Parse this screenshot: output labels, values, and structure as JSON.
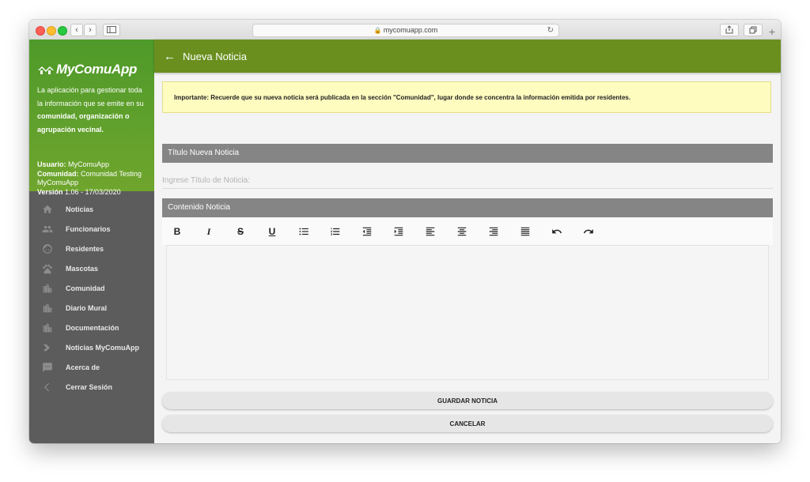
{
  "browser": {
    "url": "mycomuapp.com",
    "nav_back": "‹",
    "nav_forward": "›"
  },
  "sidebar": {
    "logo_text": "MyComuApp",
    "description": {
      "line1": "La aplicación para gestionar toda la información que se emite en su ",
      "bold": "comunidad, organización o agrupación vecinal."
    },
    "user_label": "Usuario:",
    "user_value": "MyComuApp",
    "community_label": "Comunidad:",
    "community_value": "Comunidad Testing MyComuApp",
    "version_label": "Versión",
    "version_value": "1.06 - 17/03/2020",
    "items": [
      {
        "label": "Noticias",
        "icon": "home-icon"
      },
      {
        "label": "Funcionarios",
        "icon": "people-icon"
      },
      {
        "label": "Residentes",
        "icon": "face-icon"
      },
      {
        "label": "Mascotas",
        "icon": "paw-icon"
      },
      {
        "label": "Comunidad",
        "icon": "building-icon"
      },
      {
        "label": "Diario Mural",
        "icon": "building-icon"
      },
      {
        "label": "Documentación",
        "icon": "building-icon"
      },
      {
        "label": "Noticias MyComuApp",
        "icon": "arrow-chevron-icon"
      },
      {
        "label": "Acerca de",
        "icon": "chat-icon"
      },
      {
        "label": "Cerrar Sesión",
        "icon": "chevron-left-icon"
      }
    ]
  },
  "header": {
    "back_arrow": "←",
    "title": "Nueva Noticia"
  },
  "notice": {
    "text": "Importante: Recuerde que su nueva noticia será publicada en la sección \"Comunidad\", lugar donde se concentra la información emitida por residentes."
  },
  "form": {
    "title_section": "Título Nueva Noticia",
    "title_placeholder": "Ingrese Título de Noticia:",
    "content_section": "Contenido Noticia",
    "toolbar": {
      "bold": "B",
      "italic": "I",
      "strike": "S",
      "underline": "U"
    },
    "save_label": "GUARDAR NOTICIA",
    "cancel_label": "CANCELAR"
  },
  "colors": {
    "appbar": "#6a8f1f",
    "sidebar_header": "#5f9f2b",
    "sidebar": "#5c5c5c",
    "notice_bg": "#fffcc0",
    "section_bar": "#858585"
  }
}
